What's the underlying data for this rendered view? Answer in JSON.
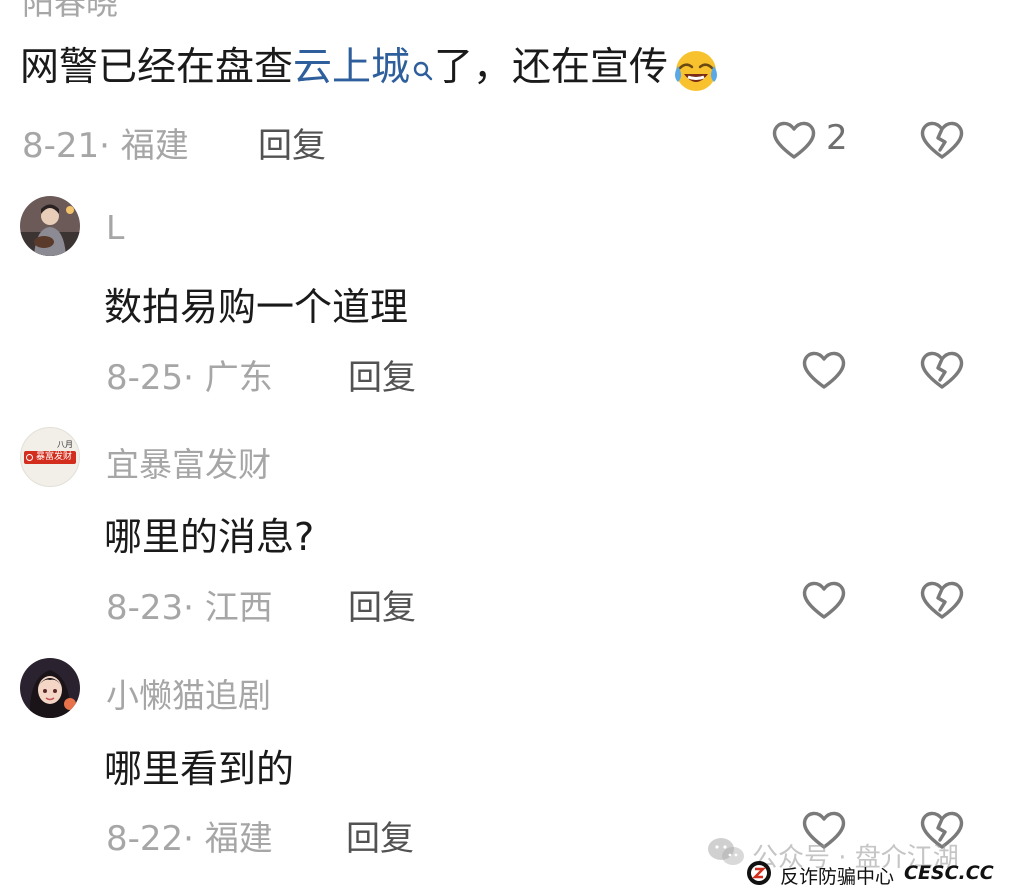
{
  "top_comment": {
    "cut_username": "阳春晓",
    "text_before": "网警已经在盘查",
    "link_text": "云上城",
    "text_after": "了，还在宣传",
    "emoji": "laughing-crying-emoji",
    "date_loc": "8-21· 福建",
    "reply_label": "回复",
    "like_count": "2"
  },
  "replies": [
    {
      "username": "L",
      "text": "数拍易购一个道理",
      "date_loc": "8-25· 广东",
      "reply_label": "回复",
      "avatar": "avatar-guitar-boy"
    },
    {
      "username": "宜暴富发财",
      "text": "哪里的消息?",
      "date_loc": "8-23· 江西",
      "reply_label": "回复",
      "avatar": "avatar-baofu-badge",
      "avatar_badge_text": "暴富发财",
      "avatar_top_text": "八月"
    },
    {
      "username": "小懒猫追剧",
      "text": "哪里看到的",
      "date_loc": "8-22· 福建",
      "reply_label": "回复",
      "avatar": "avatar-anime-girl"
    }
  ],
  "watermark": {
    "wechat_text": "公众号 · 盘介江湖",
    "badge_text": "反诈防骗中心",
    "badge_brand": "CESC.CC"
  },
  "colors": {
    "link": "#2e5f9c",
    "meta": "#a6a6a6",
    "icon_stroke": "#7a7a7a"
  }
}
